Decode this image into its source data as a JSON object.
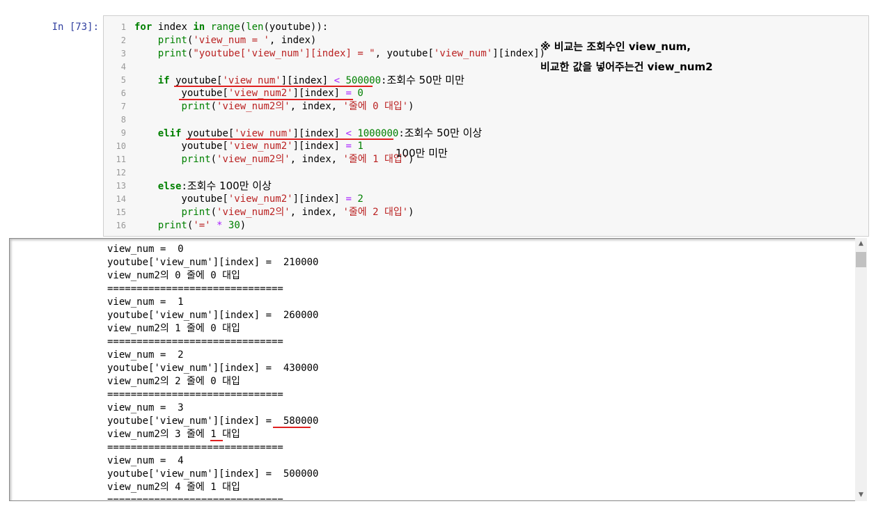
{
  "prompt": "In [73]:",
  "code_lines": [
    "for index in range(len(youtube)):",
    "    print('view_num = ', index)",
    "    print(\"youtube['view_num'][index] = \", youtube['view_num'][index])",
    "",
    "    if youtube['view_num'][index] < 500000: 조회수 50만 미만",
    "        youtube['view_num2'][index] = 0",
    "        print('view_num2의', index, '줄에 0 대입')",
    "",
    "    elif youtube['view_num'][index] < 1000000: 조회수 50만 이상",
    "        youtube['view_num2'][index] = 1",
    "        print('view_num2의', index, '줄에 1 대입')",
    "",
    "    else: 조회수 100만 이상",
    "        youtube['view_num2'][index] = 2",
    "        print('view_num2의', index, '줄에 2 대입')",
    "    print('=' * 30)"
  ],
  "line_numbers": [
    "1",
    "2",
    "3",
    "4",
    "5",
    "6",
    "7",
    "8",
    "9",
    "10",
    "11",
    "12",
    "13",
    "14",
    "15",
    "16"
  ],
  "annotations": {
    "note_line1": "※ 비교는 조회수인 view_num,",
    "note_line2": "비교한 값을 넣어주는건 view_num2",
    "if_comment": "조회수 50만 미만",
    "elif_comment": "조회수 50만 이상",
    "elif_comment2": "100만 미만",
    "else_comment": "조회수 100만 이상",
    "underline_color": "#e02020"
  },
  "output_lines": [
    "view_num =  0",
    "youtube['view_num'][index] =  210000",
    "view_num2의 0 줄에 0 대입",
    "==============================",
    "view_num =  1",
    "youtube['view_num'][index] =  260000",
    "view_num2의 1 줄에 0 대입",
    "==============================",
    "view_num =  2",
    "youtube['view_num'][index] =  430000",
    "view_num2의 2 줄에 0 대입",
    "==============================",
    "view_num =  3",
    "youtube['view_num'][index] =  580000",
    "view_num2의 3 줄에 1 대입",
    "==============================",
    "view_num =  4",
    "youtube['view_num'][index] =  500000",
    "view_num2의 4 줄에 1 대입",
    "=============================="
  ],
  "colors": {
    "prompt": "#303f9f",
    "keyword": "#008000",
    "string": "#ba2121",
    "operator": "#aa22ff",
    "cell_bg": "#f7f7f7"
  }
}
